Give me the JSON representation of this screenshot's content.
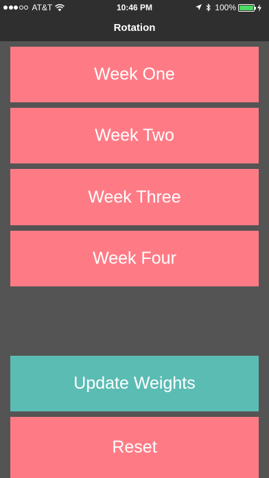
{
  "status_bar": {
    "carrier": "AT&T",
    "time": "10:46 PM",
    "battery_percent": "100%",
    "battery_level": 1.0,
    "signal_filled": 3,
    "signal_total": 5,
    "icons": [
      "wifi-icon",
      "location-arrow-icon",
      "bluetooth-icon",
      "battery-icon",
      "charging-icon"
    ]
  },
  "nav": {
    "title": "Rotation"
  },
  "weeks": [
    {
      "label": "Week One"
    },
    {
      "label": "Week Two"
    },
    {
      "label": "Week Three"
    },
    {
      "label": "Week Four"
    }
  ],
  "actions": {
    "update_label": "Update Weights",
    "reset_label": "Reset"
  },
  "colors": {
    "background": "#545454",
    "bar": "#2f2f2f",
    "pink": "#fe7b86",
    "teal": "#5bbcb4",
    "battery": "#4cd964"
  }
}
